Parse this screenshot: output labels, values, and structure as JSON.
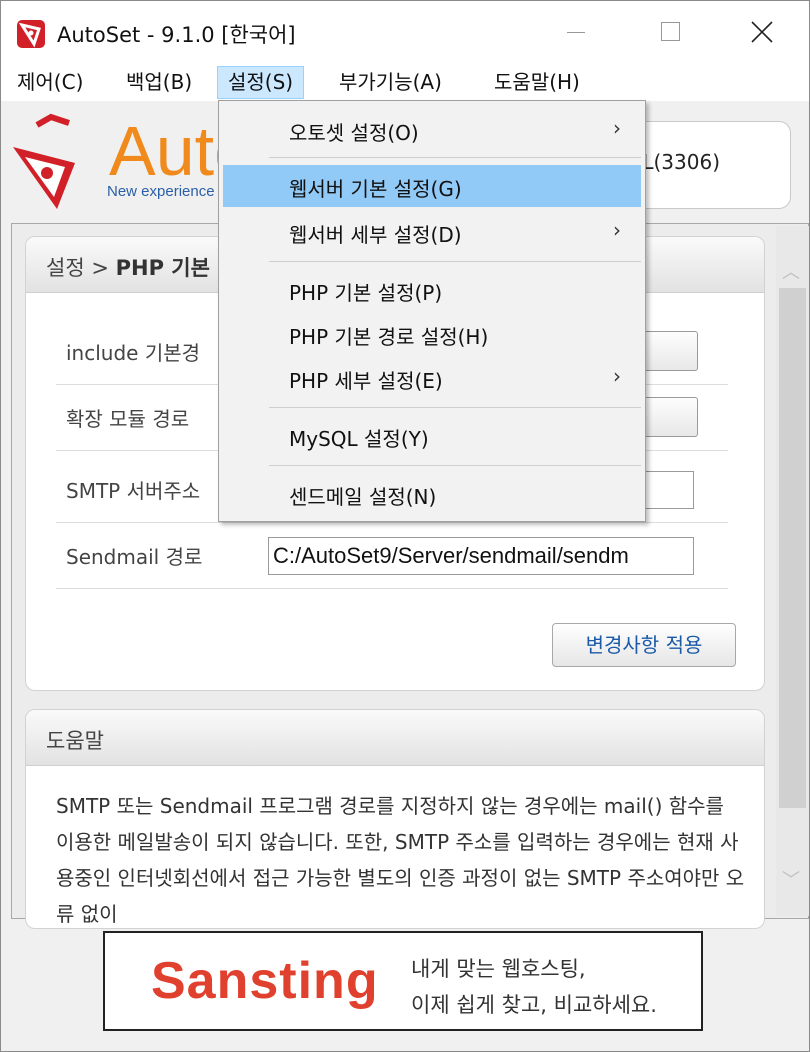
{
  "window": {
    "title": "AutoSet - 9.1.0 [한국어]"
  },
  "menubar": {
    "items": [
      "제어(C)",
      "백업(B)",
      "설정(S)",
      "부가기능(A)",
      "도움말(H)"
    ],
    "active": "설정(S)"
  },
  "header": {
    "logo_text": "Auto",
    "logo_tagline": "New experience",
    "server_status": "L(3306)"
  },
  "settings_panel": {
    "breadcrumb_prefix": "설정 >",
    "breadcrumb_page": "PHP 기본",
    "rows": [
      {
        "label": "include 기본경",
        "value": ""
      },
      {
        "label": "확장 모듈 경로",
        "value": ""
      },
      {
        "label": "SMTP 서버주소",
        "value": ""
      },
      {
        "label": "Sendmail 경로",
        "value": "C:/AutoSet9/Server/sendmail/sendm"
      }
    ],
    "apply_button": "변경사항 적용"
  },
  "help_panel": {
    "title": "도움말",
    "body": "SMTP 또는 Sendmail 프로그램 경로를 지정하지 않는 경우에는 mail() 함수를 이용한 메일발송이 되지 않습니다. 또한, SMTP 주소를 입력하는 경우에는 현재 사용중인 인터넷회선에서 접근 가능한 별도의 인증 과정이 없는 SMTP 주소여야만 오류 없이"
  },
  "banner": {
    "brand": "Sansting",
    "line1": "내게 맞는 웹호스팅,",
    "line2": "이제 쉽게 찾고, 비교하세요."
  },
  "dropdown": {
    "items": [
      {
        "label": "오토셋 설정(O)",
        "submenu": true
      },
      {
        "label": "웹서버 기본 설정(G)",
        "submenu": false,
        "highlighted": true
      },
      {
        "label": "웹서버 세부 설정(D)",
        "submenu": true
      },
      {
        "label": "PHP 기본 설정(P)",
        "submenu": false
      },
      {
        "label": "PHP 기본 경로 설정(H)",
        "submenu": false
      },
      {
        "label": "PHP 세부 설정(E)",
        "submenu": true
      },
      {
        "label": "MySQL 설정(Y)",
        "submenu": false
      },
      {
        "label": "센드메일 설정(N)",
        "submenu": false
      }
    ],
    "submenu_arrow": "›"
  },
  "colors": {
    "menu_highlight": "#91c9f7",
    "active_menu_bg": "#cce8ff",
    "brand_red": "#d12027",
    "banner_red": "#e0402e",
    "apply_text": "#1a5aa8"
  }
}
